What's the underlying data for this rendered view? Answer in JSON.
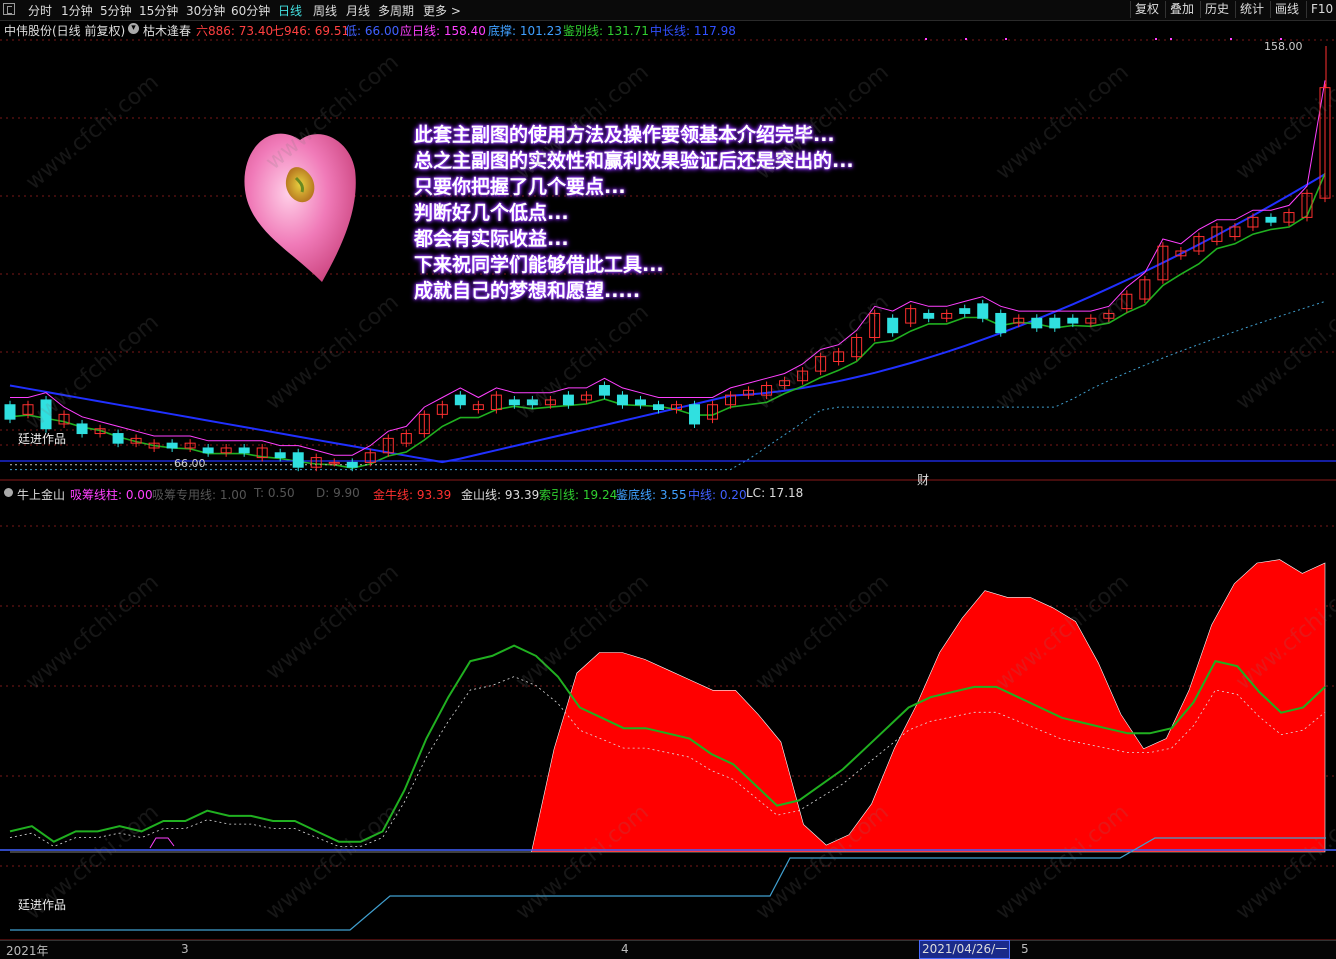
{
  "toolbar": {
    "periods": [
      "分时",
      "1分钟",
      "5分钟",
      "15分钟",
      "30分钟",
      "60分钟",
      "日线",
      "周线",
      "月线",
      "多周期",
      "更多 >"
    ],
    "active_period": "日线",
    "right_buttons": [
      "复权",
      "叠加",
      "历史",
      "统计",
      "画线",
      "F10"
    ]
  },
  "main_info": {
    "stock": "中伟股份(日线 前复权)",
    "indicator": "枯木逢春",
    "items": [
      {
        "label": "六886: 73.40",
        "color": "#ff4040"
      },
      {
        "label": "七946: 69.51",
        "color": "#ff4040"
      },
      {
        "label": "低: 66.00",
        "color": "#4060ff"
      },
      {
        "label": "应日线: 158.40",
        "color": "#ff40ff"
      },
      {
        "label": "底撑: 101.23",
        "color": "#40a0ff"
      },
      {
        "label": "鉴别线: 131.71",
        "color": "#30d030"
      },
      {
        "label": "中长线: 117.98",
        "color": "#3050ff"
      }
    ]
  },
  "price_labels": {
    "high": "158.00",
    "low": "66.00",
    "caijing": "财",
    "author": "廷进作品"
  },
  "note_lines": [
    "此套主副图的使用方法及操作要领基本介绍完毕...",
    "总之主副图的实效性和赢利效果验证后还是突出的...",
    "只要你把握了几个要点...",
    "判断好几个低点...",
    "都会有实际收益...",
    "下来祝同学们能够借此工具...",
    "成就自己的梦想和愿望....."
  ],
  "sub_info": {
    "name": "牛上金山",
    "items": [
      {
        "label": "吸筹线柱: 0.00",
        "color": "#ff40ff"
      },
      {
        "label": "吸筹专用线: 1.00",
        "color": "#555555"
      },
      {
        "label": "T: 0.50",
        "color": "#555555"
      },
      {
        "label": "D: 9.90",
        "color": "#555555"
      },
      {
        "label": "金牛线: 93.39",
        "color": "#ff3030"
      },
      {
        "label": "金山线: 93.39",
        "color": "#dddddd"
      },
      {
        "label": "索引线: 19.24",
        "color": "#30d030"
      },
      {
        "label": "鉴底线: 3.55",
        "color": "#40a0ff"
      },
      {
        "label": "中线: 0.20",
        "color": "#4060ff"
      },
      {
        "label": "LC: 17.18",
        "color": "#dddddd"
      }
    ],
    "author": "廷进作品"
  },
  "bottom": {
    "labels": [
      "2021年",
      "3",
      "4",
      "5"
    ],
    "cursor_date": "2021/04/26/一"
  },
  "watermark": "www.cfchi.com",
  "chart_data": {
    "type": "candlestick",
    "ylim": [
      66,
      158
    ],
    "candles": [
      {
        "o": 80,
        "c": 77
      },
      {
        "o": 78,
        "c": 80
      },
      {
        "o": 81,
        "c": 75
      },
      {
        "o": 76,
        "c": 78
      },
      {
        "o": 76,
        "c": 74
      },
      {
        "o": 74,
        "c": 75
      },
      {
        "o": 74,
        "c": 72
      },
      {
        "o": 72,
        "c": 73
      },
      {
        "o": 71,
        "c": 72
      },
      {
        "o": 72,
        "c": 71
      },
      {
        "o": 71,
        "c": 72
      },
      {
        "o": 71,
        "c": 70
      },
      {
        "o": 70,
        "c": 71
      },
      {
        "o": 71,
        "c": 70
      },
      {
        "o": 69,
        "c": 71
      },
      {
        "o": 70,
        "c": 69
      },
      {
        "o": 70,
        "c": 67
      },
      {
        "o": 67,
        "c": 69
      },
      {
        "o": 68,
        "c": 68
      },
      {
        "o": 68,
        "c": 67
      },
      {
        "o": 68,
        "c": 70
      },
      {
        "o": 70,
        "c": 73
      },
      {
        "o": 72,
        "c": 74
      },
      {
        "o": 74,
        "c": 78
      },
      {
        "o": 78,
        "c": 80
      },
      {
        "o": 82,
        "c": 80
      },
      {
        "o": 79,
        "c": 80
      },
      {
        "o": 79,
        "c": 82
      },
      {
        "o": 81,
        "c": 80
      },
      {
        "o": 81,
        "c": 80
      },
      {
        "o": 80,
        "c": 81
      },
      {
        "o": 82,
        "c": 80
      },
      {
        "o": 81,
        "c": 82
      },
      {
        "o": 84,
        "c": 82
      },
      {
        "o": 82,
        "c": 80
      },
      {
        "o": 81,
        "c": 80
      },
      {
        "o": 80,
        "c": 79
      },
      {
        "o": 79,
        "c": 80
      },
      {
        "o": 80,
        "c": 76
      },
      {
        "o": 77,
        "c": 80
      },
      {
        "o": 80,
        "c": 82
      },
      {
        "o": 82,
        "c": 83
      },
      {
        "o": 82,
        "c": 84
      },
      {
        "o": 84,
        "c": 85
      },
      {
        "o": 85,
        "c": 87
      },
      {
        "o": 87,
        "c": 90
      },
      {
        "o": 89,
        "c": 91
      },
      {
        "o": 90,
        "c": 94
      },
      {
        "o": 94,
        "c": 99
      },
      {
        "o": 98,
        "c": 95
      },
      {
        "o": 97,
        "c": 100
      },
      {
        "o": 99,
        "c": 98
      },
      {
        "o": 98,
        "c": 99
      },
      {
        "o": 100,
        "c": 99
      },
      {
        "o": 101,
        "c": 98
      },
      {
        "o": 99,
        "c": 95
      },
      {
        "o": 97,
        "c": 98
      },
      {
        "o": 98,
        "c": 96
      },
      {
        "o": 98,
        "c": 96
      },
      {
        "o": 98,
        "c": 97
      },
      {
        "o": 97,
        "c": 98
      },
      {
        "o": 98,
        "c": 99
      },
      {
        "o": 100,
        "c": 103
      },
      {
        "o": 102,
        "c": 106
      },
      {
        "o": 106,
        "c": 113
      },
      {
        "o": 111,
        "c": 112
      },
      {
        "o": 112,
        "c": 115
      },
      {
        "o": 114,
        "c": 117
      },
      {
        "o": 115,
        "c": 117
      },
      {
        "o": 117,
        "c": 119
      },
      {
        "o": 119,
        "c": 118
      },
      {
        "o": 118,
        "c": 120
      },
      {
        "o": 119,
        "c": 124
      },
      {
        "o": 123,
        "c": 146
      }
    ],
    "sub_chart": {
      "ylim": [
        0,
        100
      ],
      "red_area": [
        0,
        0,
        0,
        0,
        0,
        0,
        0,
        0,
        0,
        0,
        0,
        0,
        0,
        0,
        0,
        0,
        0,
        0,
        0,
        0,
        0,
        0,
        0,
        0,
        30,
        52,
        58,
        58,
        56,
        53,
        50,
        47,
        47,
        40,
        32,
        8,
        2,
        5,
        14,
        30,
        43,
        58,
        68,
        76,
        74,
        74,
        71,
        67,
        55,
        40,
        30,
        33,
        47,
        66,
        78,
        84,
        85,
        81,
        84
      ]
    }
  }
}
